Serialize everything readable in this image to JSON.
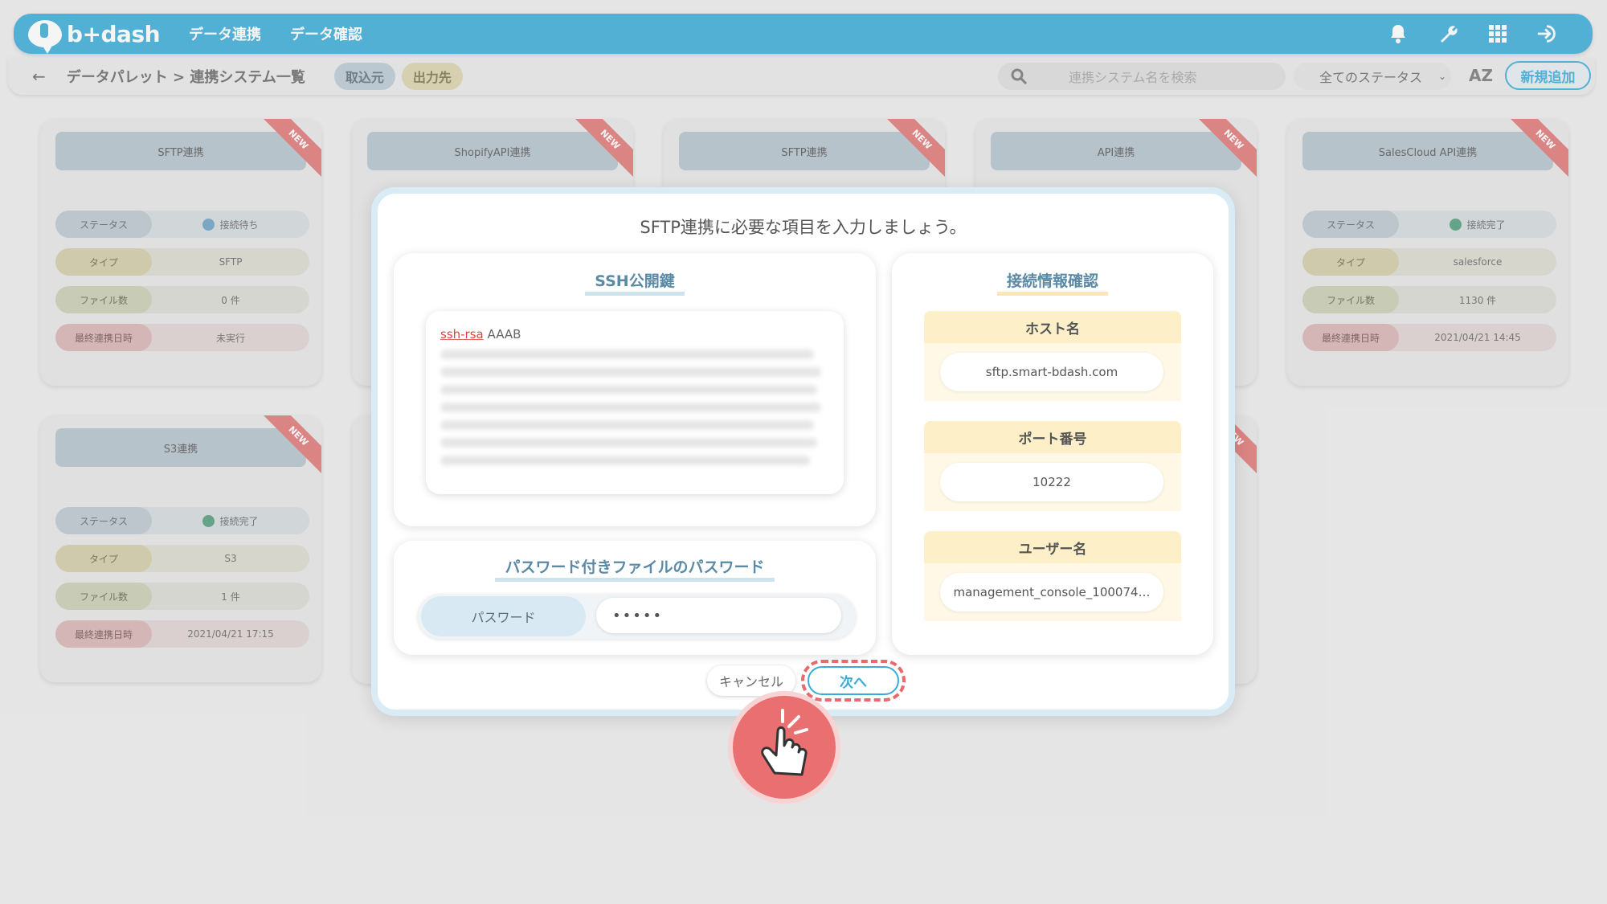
{
  "nav": {
    "logo": "b+dash",
    "items": [
      "データ連携",
      "データ確認"
    ],
    "icons": [
      "bell-icon",
      "wrench-icon",
      "grid-icon",
      "logout-icon"
    ]
  },
  "subbar": {
    "breadcrumb": "データパレット > 連携システム一覧",
    "tab_import": "取込元",
    "tab_export": "出力先",
    "search_placeholder": "連携システム名を検索",
    "status_filter": "全てのステータス",
    "sort_label": "AZ",
    "add_button": "新規追加"
  },
  "cards": [
    {
      "title": "SFTP連携",
      "ribbon": "NEW",
      "status_label": "ステータス",
      "status": "接続待ち",
      "status_kind": "wait",
      "type_label": "タイプ",
      "type": "SFTP",
      "files_label": "ファイル数",
      "files": "0 件",
      "last_label": "最終連携日時",
      "last": "未実行"
    },
    {
      "title": "ShopifyAPI連携",
      "ribbon": "NEW"
    },
    {
      "title": "SFTP連携",
      "ribbon": "NEW"
    },
    {
      "title": "API連携",
      "ribbon": "NEW"
    },
    {
      "title": "SalesCloud API連携",
      "ribbon": "NEW",
      "status_label": "ステータス",
      "status": "接続完了",
      "status_kind": "ok",
      "type_label": "タイプ",
      "type": "salesforce",
      "files_label": "ファイル数",
      "files": "1130 件",
      "last_label": "最終連携日時",
      "last": "2021/04/21 14:45"
    },
    {
      "title": "S3連携",
      "ribbon": "NEW",
      "status_label": "ステータス",
      "status": "接続完了",
      "status_kind": "ok",
      "type_label": "タイプ",
      "type": "S3",
      "files_label": "ファイル数",
      "files": "1 件",
      "last_label": "最終連携日時",
      "last": "2021/04/21 17:15"
    }
  ],
  "modal": {
    "title": "SFTP連携に必要な項目を入力しましょう。",
    "ssh": {
      "title": "SSH公開鍵",
      "key_prefix": "ssh-rsa",
      "key_start": "AAAB"
    },
    "password": {
      "title": "パスワード付きファイルのパスワード",
      "label": "パスワード",
      "value": "•••••"
    },
    "connection": {
      "title": "接続情報確認",
      "host_label": "ホスト名",
      "host": "sftp.smart-bdash.com",
      "port_label": "ポート番号",
      "port": "10222",
      "user_label": "ユーザー名",
      "user": "management_console_100074…"
    },
    "cancel": "キャンセル",
    "next": "次へ"
  },
  "colors": {
    "accent": "#3aabd8",
    "highlight": "#e86b6b"
  }
}
